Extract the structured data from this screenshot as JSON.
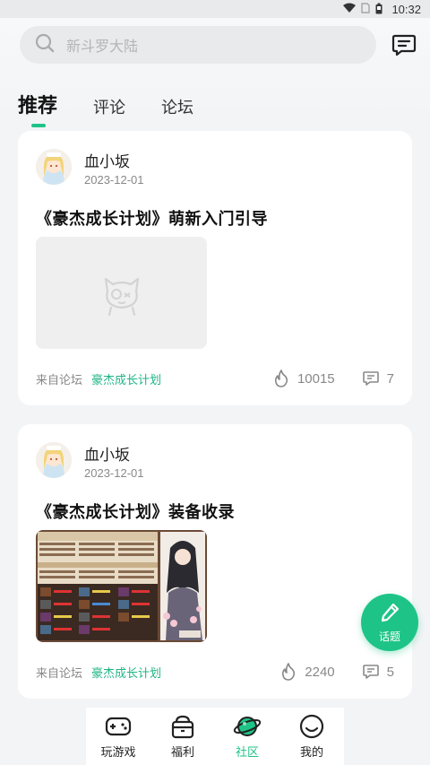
{
  "status_bar": {
    "time": "10:32",
    "icons": [
      "wifi-icon",
      "sim-icon",
      "battery-icon"
    ]
  },
  "search": {
    "placeholder": "新斗罗大陆"
  },
  "tabs": [
    {
      "label": "推荐",
      "active": true
    },
    {
      "label": "评论",
      "active": false
    },
    {
      "label": "论坛",
      "active": false
    }
  ],
  "posts": [
    {
      "author": "血小坂",
      "date": "2023-12-01",
      "title": "《豪杰成长计划》萌新入门引导",
      "image": "placeholder-image",
      "source_label": "来自论坛",
      "forum": "豪杰成长计划",
      "views": "10015",
      "comments": "7"
    },
    {
      "author": "血小坂",
      "date": "2023-12-01",
      "title": "《豪杰成长计划》装备收录",
      "image": "game-screenshot",
      "source_label": "来自论坛",
      "forum": "豪杰成长计划",
      "views": "2240",
      "comments": "5"
    }
  ],
  "fab": {
    "label": "话题"
  },
  "bottom_nav": [
    {
      "label": "玩游戏",
      "icon": "gamepad-icon",
      "active": false
    },
    {
      "label": "福利",
      "icon": "gift-box-icon",
      "active": false
    },
    {
      "label": "社区",
      "icon": "planet-icon",
      "active": true
    },
    {
      "label": "我的",
      "icon": "smiley-face-icon",
      "active": false
    }
  ],
  "colors": {
    "accent": "#1ec487",
    "forum_link": "#1fb585",
    "background": "#f3f4f6"
  }
}
